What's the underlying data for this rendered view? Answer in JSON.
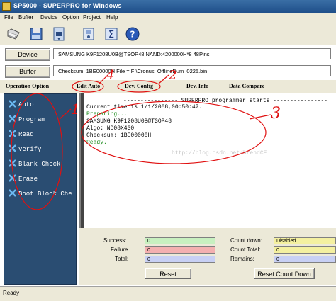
{
  "window": {
    "title": "SP5000 - SUPERPRO for Windows"
  },
  "menu": [
    "File",
    "Buffer",
    "Device",
    "Option",
    "Project",
    "Help"
  ],
  "toolbar": [
    "open-folder-icon",
    "disk-icon",
    "chip-icon",
    "save-icon",
    "sigma-icon",
    "help-icon"
  ],
  "device": {
    "button": "Device",
    "value": "SAMSUNG K9F1208U0B@TSOP48  NAND:4200000H*8  48Pins"
  },
  "buffer": {
    "button": "Buffer",
    "value": "Checksum: 1BE00000H    File = F:\\Cronus_OfflineDum_0225.bin"
  },
  "tabs": [
    "Operation Option",
    "Edit Auto",
    "Dev. Config",
    "Dev. Info",
    "Data Compare"
  ],
  "sidebar": {
    "items": [
      {
        "label": "Auto"
      },
      {
        "label": "Program"
      },
      {
        "label": "Read"
      },
      {
        "label": "Verify"
      },
      {
        "label": "Blank_Check"
      },
      {
        "label": "Erase"
      },
      {
        "label": "Boot Block Che"
      }
    ]
  },
  "console": {
    "header": "---------------- SUPERPRO programmer starts ----------------",
    "lines": [
      {
        "text": "Current time is 1/1/2008,00:50:47.",
        "color": "#000000"
      },
      {
        "text": "Preparing...",
        "color": "#1a8a1a"
      },
      {
        "text": "SAMSUNG K9F1208U0B@TSOP48",
        "color": "#000000"
      },
      {
        "text": "Algo: ND08X4S0",
        "color": "#000000"
      },
      {
        "text": "Checksum: 1BE00000H",
        "color": "#000000"
      },
      {
        "text": "Ready.",
        "color": "#1a8a1a"
      }
    ],
    "watermark": "http://blog.csdn.net/brendCE"
  },
  "stats": {
    "success": {
      "label": "Success:",
      "value": "0",
      "color": "#c8f0c0"
    },
    "failure": {
      "label": "Failure",
      "value": "0",
      "color": "#f4b0b0"
    },
    "total": {
      "label": "Total:",
      "value": "0",
      "color": "#c8d0f4"
    },
    "count_down": {
      "label": "Count down:",
      "value": "Disabled",
      "color": "#f4f0a0"
    },
    "count_total": {
      "label": "Count Total:",
      "value": "0",
      "color": "#f4f0a0"
    },
    "remains": {
      "label": "Remains:",
      "value": "0",
      "color": "#c8d0f4"
    },
    "reset_button": "Reset",
    "reset_count_button": "Reset Count Down"
  },
  "status": {
    "text": "Ready"
  },
  "annotations": {
    "n1": "1",
    "n2": "2",
    "n3": "3",
    "n4": "4",
    "color": "#e01010"
  }
}
